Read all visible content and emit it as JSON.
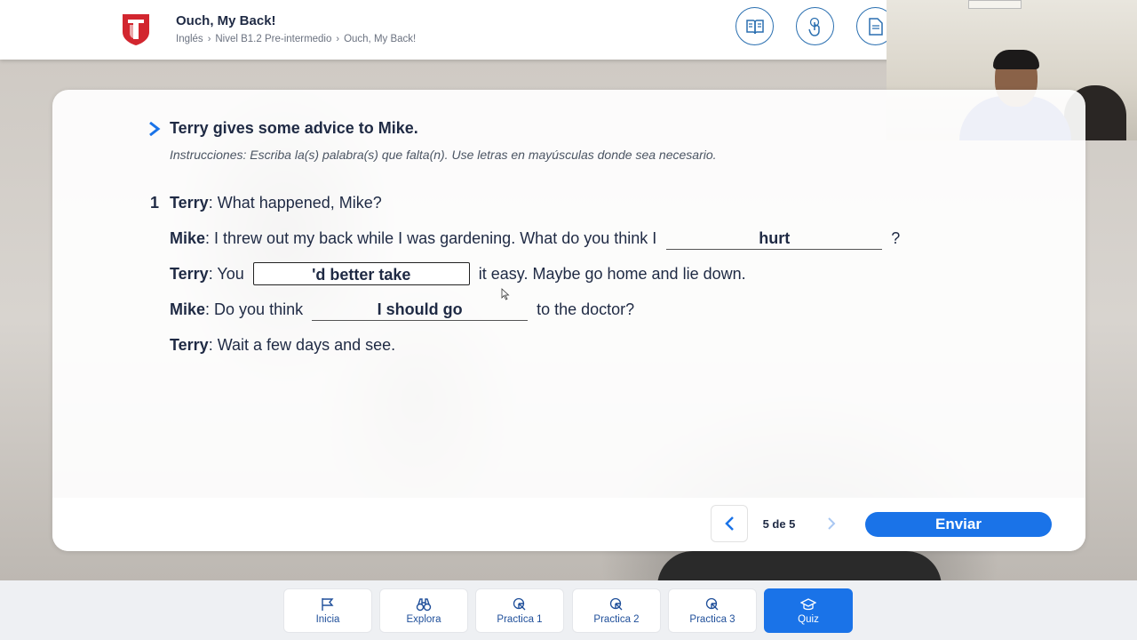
{
  "header": {
    "title": "Ouch, My Back!",
    "breadcrumb": [
      "Inglés",
      "Nivel B1.2 Pre-intermedio",
      "Ouch, My Back!"
    ],
    "buttons": [
      "book-icon",
      "touch-icon",
      "document-icon"
    ],
    "brand_color": "#d2262f"
  },
  "question": {
    "title": "Terry gives some advice to Mike.",
    "instructions": "Instrucciones: Escriba la(s) palabra(s) que falta(n). Use letras en mayúsculas donde sea necesario.",
    "number": "1",
    "lines": [
      {
        "speaker": "Terry",
        "before": ": What happened, Mike?"
      },
      {
        "speaker": "Mike",
        "before": ": I threw out my back while I was gardening. What do you think I",
        "answer": "hurt",
        "after": "?"
      },
      {
        "speaker": "Terry",
        "before": ": You",
        "answer": "'d better take",
        "after": "it easy. Maybe go home and lie down."
      },
      {
        "speaker": "Mike",
        "before": ": Do you think",
        "answer": "I should go",
        "after": "to the doctor?"
      },
      {
        "speaker": "Terry",
        "before": ": Wait a few days and see."
      }
    ]
  },
  "pager": {
    "label": "5 de 5"
  },
  "send_label": "Enviar",
  "nav": {
    "tabs": [
      {
        "label": "Inicia",
        "icon": "flag-icon"
      },
      {
        "label": "Explora",
        "icon": "binoculars-icon"
      },
      {
        "label": "Practica 1",
        "icon": "pointer-icon"
      },
      {
        "label": "Practica 2",
        "icon": "pointer-icon"
      },
      {
        "label": "Practica 3",
        "icon": "pointer-icon"
      },
      {
        "label": "Quiz",
        "icon": "graduation-cap-icon"
      }
    ],
    "active": "Quiz"
  },
  "accent_color": "#1a73e8"
}
